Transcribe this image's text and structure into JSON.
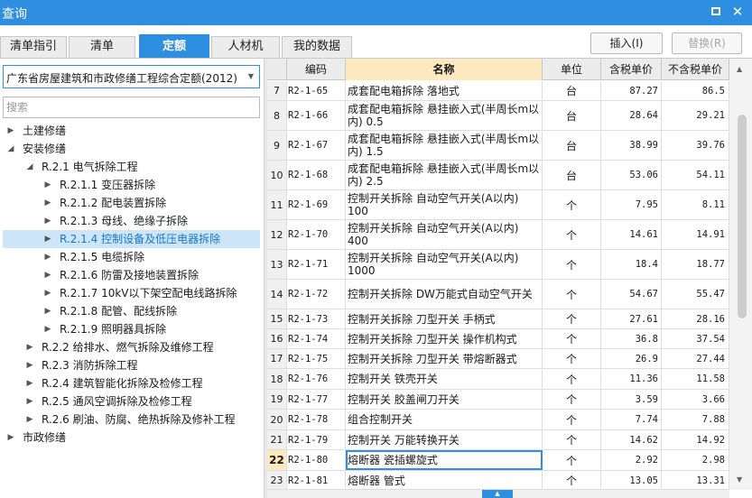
{
  "window": {
    "title": "查询",
    "maximize_glyph": "",
    "close_glyph": "✕"
  },
  "tabs": [
    {
      "label": "清单指引",
      "active": false
    },
    {
      "label": "清单",
      "active": false
    },
    {
      "label": "定额",
      "active": true
    },
    {
      "label": "人材机",
      "active": false
    },
    {
      "label": "我的数据",
      "active": false
    }
  ],
  "actions": {
    "insert_label": "插入(I)",
    "replace_label": "替换(R)"
  },
  "left": {
    "quota_library": "广东省房屋建筑和市政修缮工程综合定额(2012)",
    "search_placeholder": "搜索",
    "tree": [
      {
        "text": "土建修缮",
        "expanded": false,
        "level": 0
      },
      {
        "text": "安装修缮",
        "expanded": true,
        "level": 0
      },
      {
        "text": "R.2.1 电气拆除工程",
        "expanded": true,
        "level": 1
      },
      {
        "text": "R.2.1.1 变压器拆除",
        "expanded": false,
        "level": 2
      },
      {
        "text": "R.2.1.2 配电装置拆除",
        "expanded": false,
        "level": 2
      },
      {
        "text": "R.2.1.3 母线、绝缘子拆除",
        "expanded": false,
        "level": 2
      },
      {
        "text": "R.2.1.4 控制设备及低压电器拆除",
        "expanded": false,
        "level": 2,
        "selected": true
      },
      {
        "text": "R.2.1.5 电缆拆除",
        "expanded": false,
        "level": 2
      },
      {
        "text": "R.2.1.6 防雷及接地装置拆除",
        "expanded": false,
        "level": 2
      },
      {
        "text": "R.2.1.7 10kV以下架空配电线路拆除",
        "expanded": false,
        "level": 2
      },
      {
        "text": "R.2.1.8 配管、配线拆除",
        "expanded": false,
        "level": 2
      },
      {
        "text": "R.2.1.9 照明器具拆除",
        "expanded": false,
        "level": 2
      },
      {
        "text": "R.2.2 给排水、燃气拆除及维修工程",
        "expanded": false,
        "level": 1
      },
      {
        "text": "R.2.3 消防拆除工程",
        "expanded": false,
        "level": 1
      },
      {
        "text": "R.2.4 建筑智能化拆除及检修工程",
        "expanded": false,
        "level": 1
      },
      {
        "text": "R.2.5 通风空调拆除及检修工程",
        "expanded": false,
        "level": 1
      },
      {
        "text": "R.2.6 刷油、防腐、绝热拆除及修补工程",
        "expanded": false,
        "level": 1
      },
      {
        "text": "市政修缮",
        "expanded": false,
        "level": 0
      }
    ]
  },
  "grid": {
    "headers": {
      "code": "编码",
      "name": "名称",
      "unit": "单位",
      "tax_price": "含税单价",
      "notax_price": "不含税单价"
    },
    "rows": [
      {
        "num": "7",
        "code": "R2-1-65",
        "name": "成套配电箱拆除 落地式",
        "unit": "台",
        "tax": "87.27",
        "notax": "86.5"
      },
      {
        "num": "8",
        "code": "R2-1-66",
        "name": "成套配电箱拆除 悬挂嵌入式(半周长m以内) 0.5",
        "unit": "台",
        "tax": "28.64",
        "notax": "29.21"
      },
      {
        "num": "9",
        "code": "R2-1-67",
        "name": "成套配电箱拆除 悬挂嵌入式(半周长m以内) 1.5",
        "unit": "台",
        "tax": "38.99",
        "notax": "39.76"
      },
      {
        "num": "10",
        "code": "R2-1-68",
        "name": "成套配电箱拆除 悬挂嵌入式(半周长m以内) 2.5",
        "unit": "台",
        "tax": "53.06",
        "notax": "54.11"
      },
      {
        "num": "11",
        "code": "R2-1-69",
        "name": "控制开关拆除 自动空气开关(A以内) 100",
        "unit": "个",
        "tax": "7.95",
        "notax": "8.11"
      },
      {
        "num": "12",
        "code": "R2-1-70",
        "name": "控制开关拆除 自动空气开关(A以内) 400",
        "unit": "个",
        "tax": "14.61",
        "notax": "14.91"
      },
      {
        "num": "13",
        "code": "R2-1-71",
        "name": "控制开关拆除 自动空气开关(A以内) 1000",
        "unit": "个",
        "tax": "18.4",
        "notax": "18.77"
      },
      {
        "num": "14",
        "code": "R2-1-72",
        "name": "控制开关拆除 DW万能式自动空气开关",
        "unit": "个",
        "tax": "54.67",
        "notax": "55.47"
      },
      {
        "num": "15",
        "code": "R2-1-73",
        "name": "控制开关拆除 刀型开关 手柄式",
        "unit": "个",
        "tax": "27.61",
        "notax": "28.16"
      },
      {
        "num": "16",
        "code": "R2-1-74",
        "name": "控制开关拆除 刀型开关 操作机构式",
        "unit": "个",
        "tax": "36.8",
        "notax": "37.54"
      },
      {
        "num": "17",
        "code": "R2-1-75",
        "name": "控制开关拆除 刀型开关 带熔断器式",
        "unit": "个",
        "tax": "26.9",
        "notax": "27.44"
      },
      {
        "num": "18",
        "code": "R2-1-76",
        "name": "控制开关 铁壳开关",
        "unit": "个",
        "tax": "11.36",
        "notax": "11.58"
      },
      {
        "num": "19",
        "code": "R2-1-77",
        "name": "控制开关 胶盖闸刀开关",
        "unit": "个",
        "tax": "3.59",
        "notax": "3.66"
      },
      {
        "num": "20",
        "code": "R2-1-78",
        "name": "组合控制开关",
        "unit": "个",
        "tax": "7.74",
        "notax": "7.88"
      },
      {
        "num": "21",
        "code": "R2-1-79",
        "name": "控制开关 万能转换开关",
        "unit": "个",
        "tax": "14.62",
        "notax": "14.92"
      },
      {
        "num": "22",
        "code": "R2-1-80",
        "name": "熔断器 瓷插螺旋式",
        "unit": "个",
        "tax": "2.92",
        "notax": "2.98",
        "current": true
      },
      {
        "num": "23",
        "code": "R2-1-81",
        "name": "熔断器 管式",
        "unit": "个",
        "tax": "13.05",
        "notax": "13.31"
      }
    ]
  },
  "colors": {
    "accent": "#2e8ee0",
    "header_highlight": "#fde9bf",
    "selection": "#cce5f8"
  }
}
